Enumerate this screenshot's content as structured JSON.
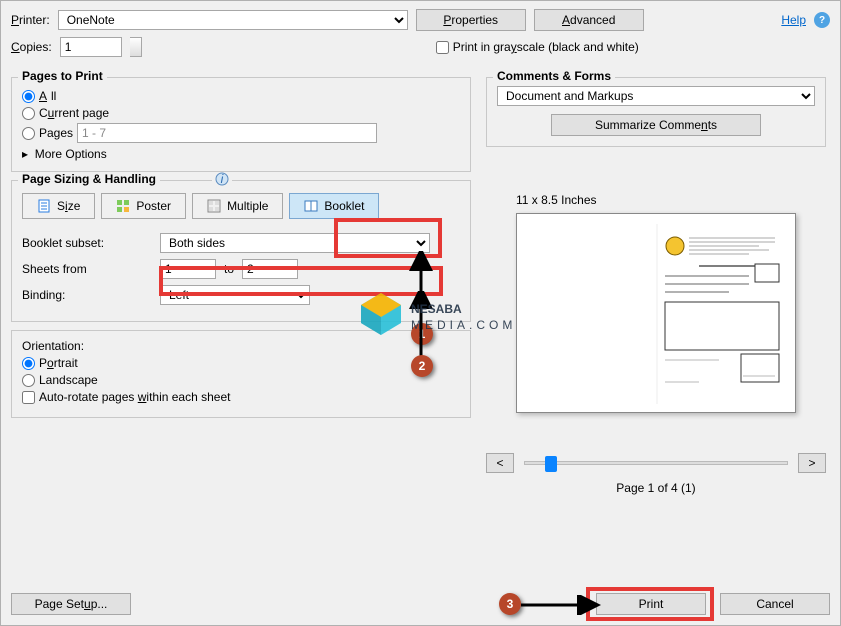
{
  "header": {
    "printer_label": "Printer:",
    "printer_value": "OneNote",
    "copies_label": "Copies:",
    "copies_value": "1",
    "properties_btn": "Properties",
    "advanced_btn": "Advanced",
    "grayscale_label": "Print in grayscale (black and white)",
    "help": "Help"
  },
  "pages_to_print": {
    "title": "Pages to Print",
    "all": "All",
    "current": "Current page",
    "pages": "Pages",
    "pages_range": "1 - 7",
    "more_options": "More Options"
  },
  "sizing": {
    "title": "Page Sizing & Handling",
    "size": "Size",
    "poster": "Poster",
    "multiple": "Multiple",
    "booklet": "Booklet",
    "subset_label": "Booklet subset:",
    "subset_value": "Both sides",
    "sheets_label": "Sheets from",
    "sheets_from": "1",
    "sheets_to_lbl": "to",
    "sheets_to": "2",
    "binding_label": "Binding:",
    "binding_value": "Left"
  },
  "orientation": {
    "title": "Orientation:",
    "portrait": "Portrait",
    "landscape": "Landscape",
    "autorotate": "Auto-rotate pages within each sheet"
  },
  "comments": {
    "title": "Comments & Forms",
    "value": "Document and Markups",
    "summarize": "Summarize Comments"
  },
  "preview": {
    "dims": "11 x 8.5 Inches",
    "page_status": "Page 1 of 4 (1)",
    "prev": "<",
    "next": ">"
  },
  "bottom": {
    "page_setup": "Page Setup...",
    "print": "Print",
    "cancel": "Cancel"
  },
  "annotations": {
    "c1": "1",
    "c2": "2",
    "c3": "3"
  },
  "watermark": {
    "line1": "NESABA",
    "line2": "MEDIA.COM"
  }
}
